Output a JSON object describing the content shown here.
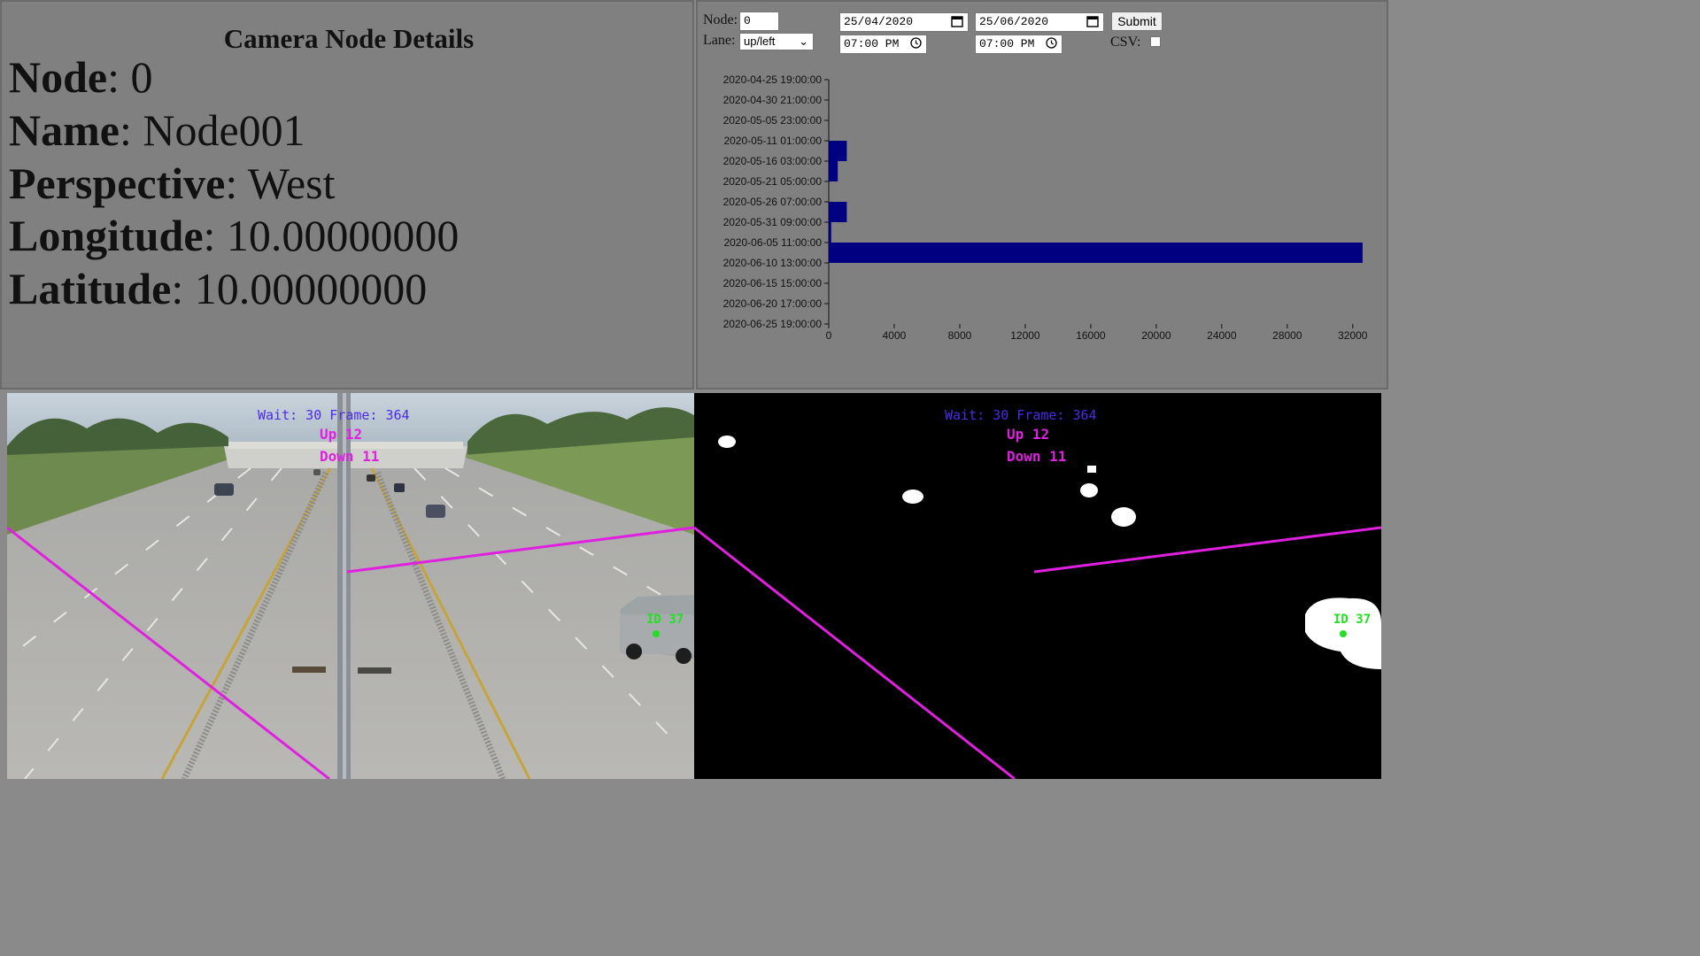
{
  "details": {
    "title": "Camera Node Details",
    "rows": [
      {
        "label": "Node",
        "value": ": 0"
      },
      {
        "label": "Name",
        "value": ": Node001"
      },
      {
        "label": "Perspective",
        "value": ": West"
      },
      {
        "label": "Longitude",
        "value": ": 10.00000000"
      },
      {
        "label": "Latitude",
        "value": ": 10.00000000"
      }
    ]
  },
  "form": {
    "node_label": "Node:",
    "node_value": "0",
    "lane_label": "Lane:",
    "lane_value": "up/left",
    "start_date": "25/04/2020",
    "start_time": "07:00 PM",
    "end_date": "25/06/2020",
    "end_time": "07:00 PM",
    "submit_label": "Submit",
    "csv_label": "CSV:",
    "csv_checked": false
  },
  "chart_data": {
    "type": "bar",
    "orientation": "horizontal",
    "categories": [
      "2020-04-25 19:00:00",
      "2020-04-30 21:00:00",
      "2020-05-05 23:00:00",
      "2020-05-11 01:00:00",
      "2020-05-16 03:00:00",
      "2020-05-21 05:00:00",
      "2020-05-26 07:00:00",
      "2020-05-31 09:00:00",
      "2020-06-05 11:00:00",
      "2020-06-10 13:00:00",
      "2020-06-15 15:00:00",
      "2020-06-20 17:00:00",
      "2020-06-25 19:00:00"
    ],
    "values": [
      0,
      0,
      0,
      1100,
      550,
      0,
      1100,
      150,
      32600,
      0,
      0,
      0,
      0
    ],
    "xticks": [
      0,
      4000,
      8000,
      12000,
      16000,
      20000,
      24000,
      28000,
      32000
    ],
    "xlim": [
      0,
      33200
    ],
    "bar_color": "#000080",
    "title": "",
    "xlabel": "",
    "ylabel": ""
  },
  "camera": {
    "wait_text": "Wait: 30 Frame: 364",
    "up_text": "Up 12",
    "down_text": "Down 11",
    "id_text": "ID 37",
    "line_color": "#e020e0"
  }
}
